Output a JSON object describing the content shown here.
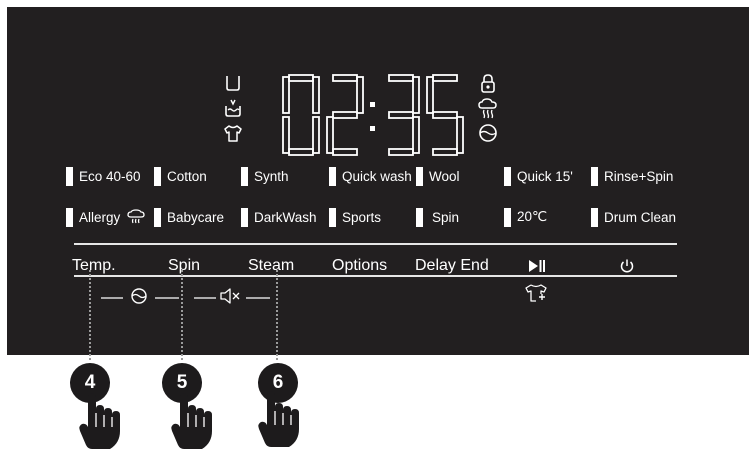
{
  "display": {
    "time_digits": [
      "0",
      "2",
      "3",
      "5"
    ],
    "time_separator": ":",
    "left_status_icons": [
      "detergent-tray-icon",
      "prewash-basin-icon",
      "shirt-icon"
    ],
    "right_status_icons": [
      "child-lock-icon",
      "steam-icon",
      "soil-level-icon"
    ]
  },
  "programs": [
    {
      "label": "Eco 40-60"
    },
    {
      "label": "Cotton"
    },
    {
      "label": "Synth"
    },
    {
      "label": "Quick wash"
    },
    {
      "label": "Wool"
    },
    {
      "label": "Quick 15'"
    },
    {
      "label": "Rinse+Spin"
    },
    {
      "label": "Allergy"
    },
    {
      "label": "Babycare"
    },
    {
      "label": "DarkWash"
    },
    {
      "label": "Sports"
    },
    {
      "label": "Spin"
    },
    {
      "label": "20℃"
    },
    {
      "label": "Drum Clean"
    }
  ],
  "buttons": {
    "temp": "Temp.",
    "spin": "Spin",
    "steam": "Steam",
    "options": "Options",
    "delay_end": "Delay End",
    "start_pause_icon": "play-pause-icon",
    "power_icon": "power-icon"
  },
  "sub_icons": [
    "soil-level-icon",
    "mute-icon",
    "add-garment-icon"
  ],
  "callouts": [
    {
      "number": "4"
    },
    {
      "number": "5"
    },
    {
      "number": "6"
    }
  ],
  "colors": {
    "panel_background": "#221f20",
    "panel_foreground": "#ffffff",
    "callout_background": "#1d1b1c",
    "leader_line": "#9b9b9b"
  }
}
